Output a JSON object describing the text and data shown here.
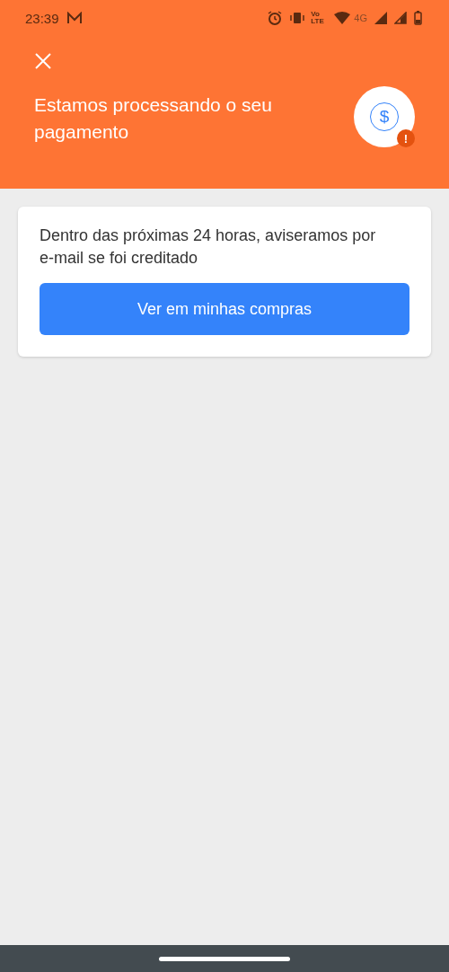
{
  "status_bar": {
    "time": "23:39",
    "volte": "Vo LTE",
    "network": "4G"
  },
  "header": {
    "title": "Estamos processando o seu pagamento",
    "icon_symbol": "$",
    "badge_symbol": "!"
  },
  "card": {
    "message": "Dentro das próximas 24 horas, aviseramos por e-mail se foi creditado",
    "button": "Ver em minhas compras"
  }
}
